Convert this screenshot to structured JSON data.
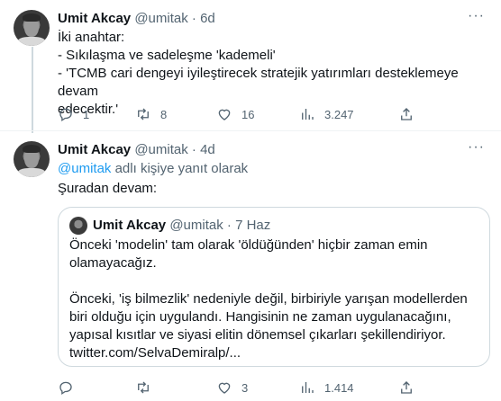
{
  "tweet1": {
    "name": "Umit Akcay",
    "handle": "@umitak",
    "dot": "·",
    "time": "6d",
    "lines": [
      "İki anahtar:",
      "- Sıkılaşma ve sadeleşme 'kademeli'",
      "- 'TCMB cari dengeyi iyileştirecek stratejik yatırımları desteklemeye devam",
      "edecektir.'"
    ],
    "replies": "1",
    "reposts": "8",
    "likes": "16",
    "views": "3.247"
  },
  "tweet2": {
    "name": "Umit Akcay",
    "handle": "@umitak",
    "dot": "·",
    "time": "4d",
    "reply_mention": "@umitak",
    "reply_suffix": " adlı kişiye yanıt olarak",
    "text": "Şuradan devam:",
    "quote": {
      "name": "Umit Akcay",
      "handle": "@umitak",
      "dot": "·",
      "time": "7 Haz",
      "para1": "Önceki 'modelin' tam olarak 'öldüğünden' hiçbir zaman emin olamayacağız.",
      "para2": "Önceki, 'iş bilmezlik' nedeniyle değil, birbiriyle yarışan modellerden biri olduğu için uygulandı. Hangisinin ne zaman uygulanacağını, yapısal kısıtlar ve siyasi elitin dönemsel çıkarları şekillendiriyor. twitter.com/SelvaDemiralp/..."
    },
    "replies": "",
    "reposts": "",
    "likes": "3",
    "views": "1.414"
  },
  "more_label": "···",
  "colors": {
    "accent": "#1d9bf0",
    "muted": "#536471",
    "text": "#0f1419",
    "border": "#cfd9de"
  },
  "icons": [
    "reply-icon",
    "repost-icon",
    "like-icon",
    "views-icon",
    "share-icon",
    "more-icon"
  ]
}
